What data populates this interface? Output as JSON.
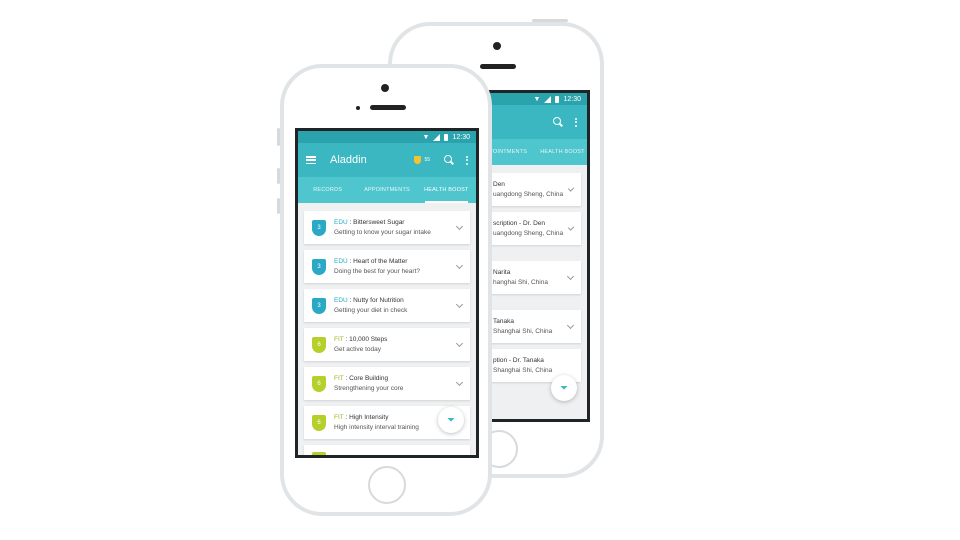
{
  "colors": {
    "accent": "#3ab7c0",
    "edu": "#2aa9c6",
    "fit": "#b7cf2a"
  },
  "status": {
    "time": "12:30"
  },
  "front": {
    "app_title": "Aladdin",
    "points": "55",
    "tabs": [
      {
        "label": "RECORDS",
        "active": false
      },
      {
        "label": "APPOINTMENTS",
        "active": false
      },
      {
        "label": "HEALTH BOOST",
        "active": true
      }
    ],
    "cards": [
      {
        "badge": "3",
        "category": "EDU",
        "title": "Bittersweet Sugar",
        "subtitle": "Getting to know your sugar intake"
      },
      {
        "badge": "3",
        "category": "EDU",
        "title": "Heart of the Matter",
        "subtitle": "Doing the best for your heart?"
      },
      {
        "badge": "3",
        "category": "EDU",
        "title": "Nutty for Nutrition",
        "subtitle": "Getting your diet in check"
      },
      {
        "badge": "6",
        "category": "FIT",
        "title": "10,000 Steps",
        "subtitle": "Get active today"
      },
      {
        "badge": "6",
        "category": "FIT",
        "title": "Core Building",
        "subtitle": "Strengthening your core"
      },
      {
        "badge": "6",
        "category": "FIT",
        "title": "High Intensity",
        "subtitle": "High intensity interval training"
      }
    ],
    "separator": ":"
  },
  "back": {
    "tabs": [
      {
        "label": "POINTMENTS",
        "active": false
      },
      {
        "label": "HEALTH BOOST",
        "active": false
      }
    ],
    "cards": [
      {
        "title": "Den",
        "subtitle": "uangdong Sheng, China"
      },
      {
        "title": "scription - Dr. Den",
        "subtitle": "uangdong Sheng, China"
      },
      {
        "title": "Narita",
        "subtitle": "hanghai Shi, China"
      },
      {
        "title": "Tanaka",
        "subtitle": "Shanghai Shi, China"
      },
      {
        "title": "ption - Dr. Tanaka",
        "subtitle": "Shanghai Shi, China"
      }
    ]
  }
}
